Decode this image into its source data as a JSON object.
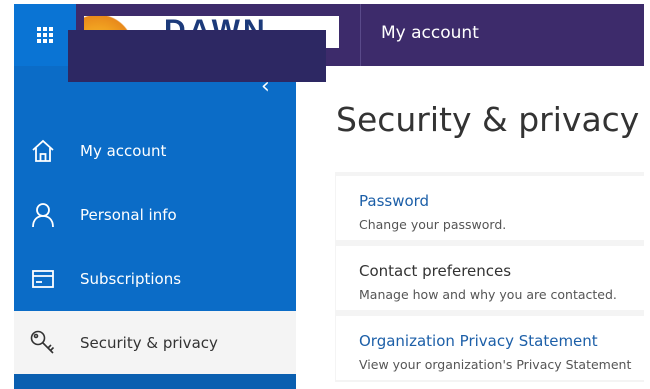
{
  "header": {
    "logo_text": "DAWN",
    "app_title": "My account"
  },
  "sidebar": {
    "collapse_glyph": "‹",
    "items": [
      {
        "label": "My account",
        "icon": "home-icon",
        "active": false
      },
      {
        "label": "Personal info",
        "icon": "person-icon",
        "active": false
      },
      {
        "label": "Subscriptions",
        "icon": "card-icon",
        "active": false
      },
      {
        "label": "Security & privacy",
        "icon": "key-icon",
        "active": true
      }
    ]
  },
  "main": {
    "title": "Security & privacy",
    "cards": [
      {
        "title": "Password",
        "subtitle": "Change your password.",
        "is_link": true
      },
      {
        "title": "Contact preferences",
        "subtitle": "Manage how and why you are contacted.",
        "is_link": false
      },
      {
        "title": "Organization Privacy Statement",
        "subtitle": "View your organization's Privacy Statement",
        "is_link": true
      }
    ]
  },
  "colors": {
    "topbar": "#3d2b6b",
    "waffle": "#0a74d4",
    "sidebar": "#0b6cc7",
    "link": "#1c5fa8"
  }
}
